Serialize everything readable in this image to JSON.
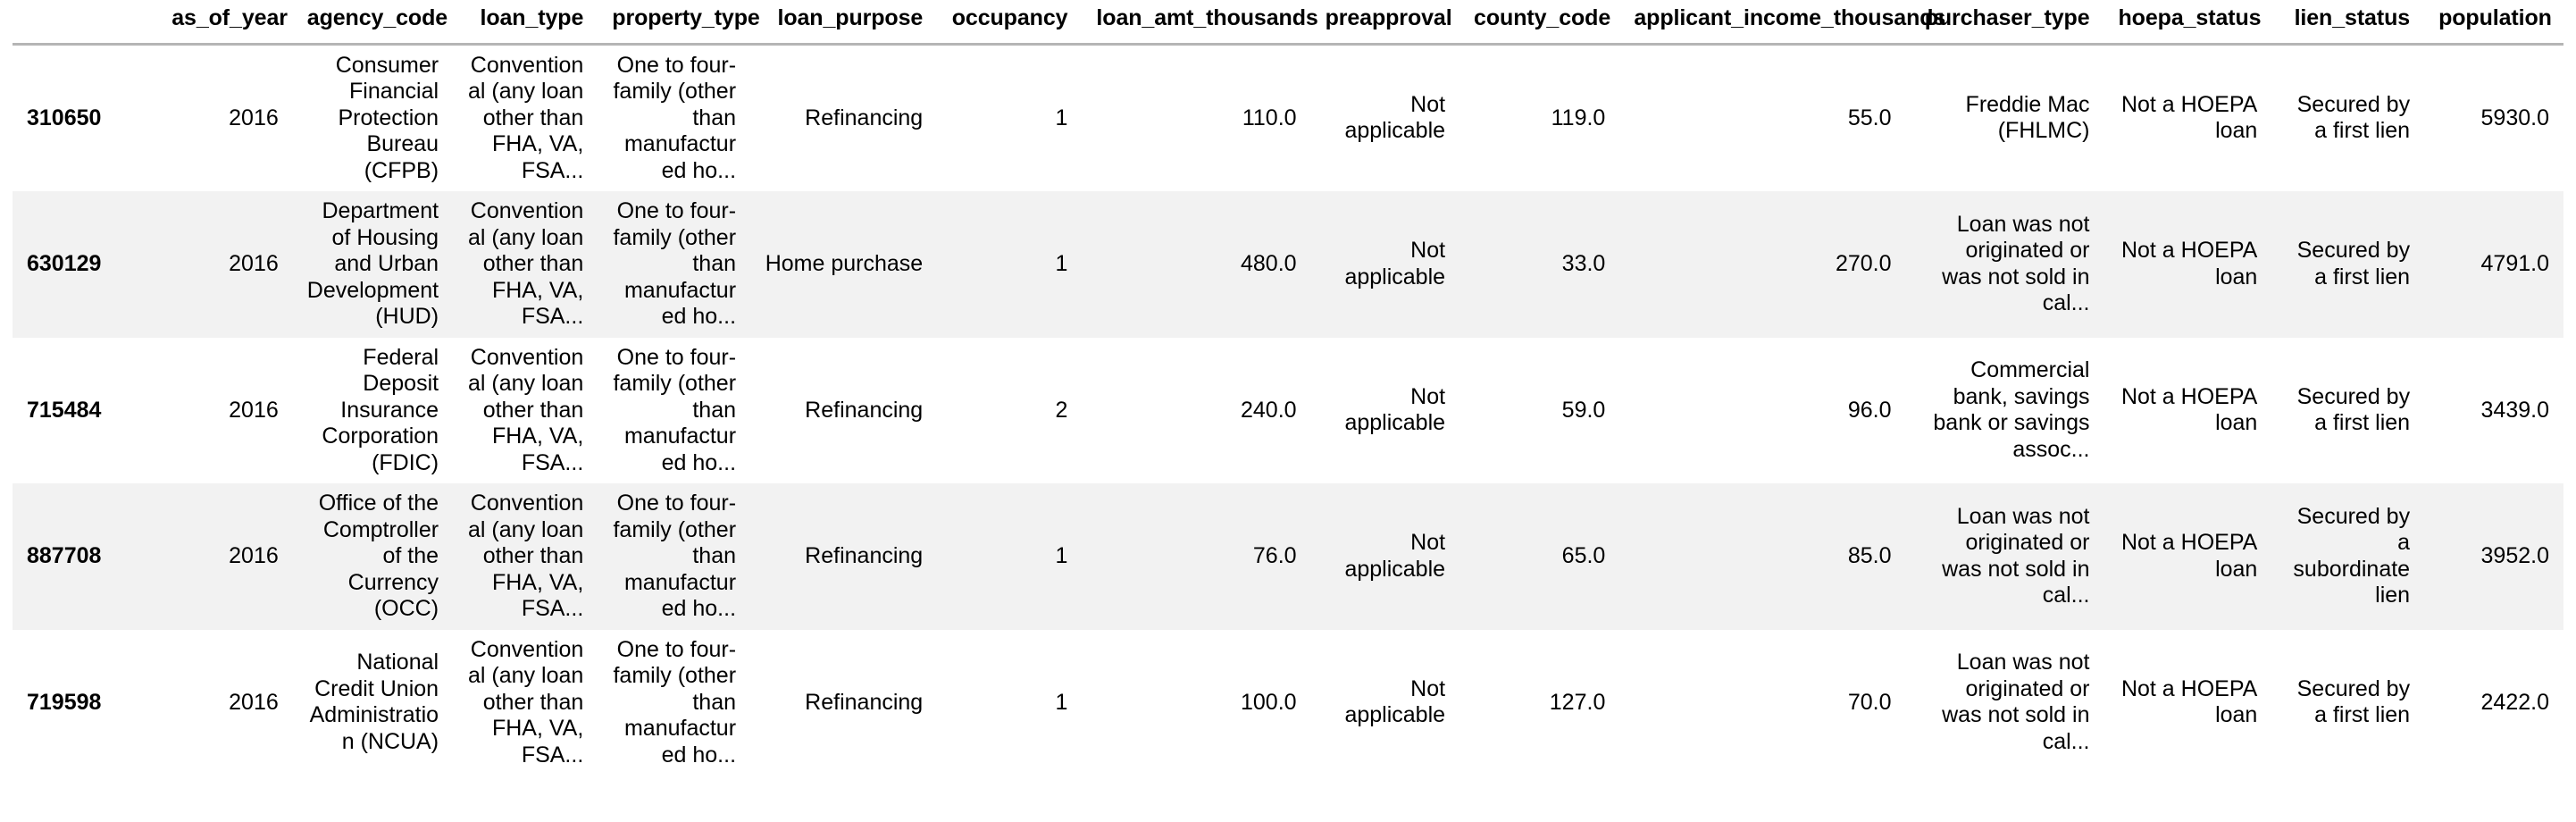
{
  "table": {
    "index_header": "",
    "columns": [
      "as_of_year",
      "agency_code",
      "loan_type",
      "property_type",
      "loan_purpose",
      "occupancy",
      "loan_amt_thousands",
      "preapproval",
      "county_code",
      "applicant_income_thousands",
      "purchaser_type",
      "hoepa_status",
      "lien_status",
      "population"
    ],
    "rows": [
      {
        "index": "310650",
        "cells": [
          "2016",
          "Consumer Financial Protection Bureau (CFPB)",
          "Conventional (any loan other than FHA, VA, FSA...",
          "One to four-family (other than manufactured ho...",
          "Refinancing",
          "1",
          "110.0",
          "Not applicable",
          "119.0",
          "55.0",
          "Freddie Mac (FHLMC)",
          "Not a HOEPA loan",
          "Secured by a first lien",
          "5930.0"
        ]
      },
      {
        "index": "630129",
        "cells": [
          "2016",
          "Department of Housing and Urban Development (HUD)",
          "Conventional (any loan other than FHA, VA, FSA...",
          "One to four-family (other than manufactured ho...",
          "Home purchase",
          "1",
          "480.0",
          "Not applicable",
          "33.0",
          "270.0",
          "Loan was not originated or was not sold in cal...",
          "Not a HOEPA loan",
          "Secured by a first lien",
          "4791.0"
        ]
      },
      {
        "index": "715484",
        "cells": [
          "2016",
          "Federal Deposit Insurance Corporation (FDIC)",
          "Conventional (any loan other than FHA, VA, FSA...",
          "One to four-family (other than manufactured ho...",
          "Refinancing",
          "2",
          "240.0",
          "Not applicable",
          "59.0",
          "96.0",
          "Commercial bank, savings bank or savings assoc...",
          "Not a HOEPA loan",
          "Secured by a first lien",
          "3439.0"
        ]
      },
      {
        "index": "887708",
        "cells": [
          "2016",
          "Office of the Comptroller of the Currency (OCC)",
          "Conventional (any loan other than FHA, VA, FSA...",
          "One to four-family (other than manufactured ho...",
          "Refinancing",
          "1",
          "76.0",
          "Not applicable",
          "65.0",
          "85.0",
          "Loan was not originated or was not sold in cal...",
          "Not a HOEPA loan",
          "Secured by a subordinate lien",
          "3952.0"
        ]
      },
      {
        "index": "719598",
        "cells": [
          "2016",
          "National Credit Union Administration (NCUA)",
          "Conventional (any loan other than FHA, VA, FSA...",
          "One to four-family (other than manufactured ho...",
          "Refinancing",
          "1",
          "100.0",
          "Not applicable",
          "127.0",
          "70.0",
          "Loan was not originated or was not sold in cal...",
          "Not a HOEPA loan",
          "Secured by a first lien",
          "2422.0"
        ]
      }
    ],
    "colors": {
      "background": "#ffffff",
      "stripe": "#f2f2f2",
      "text": "#000000",
      "header_rule": "#b5b5b5"
    }
  }
}
